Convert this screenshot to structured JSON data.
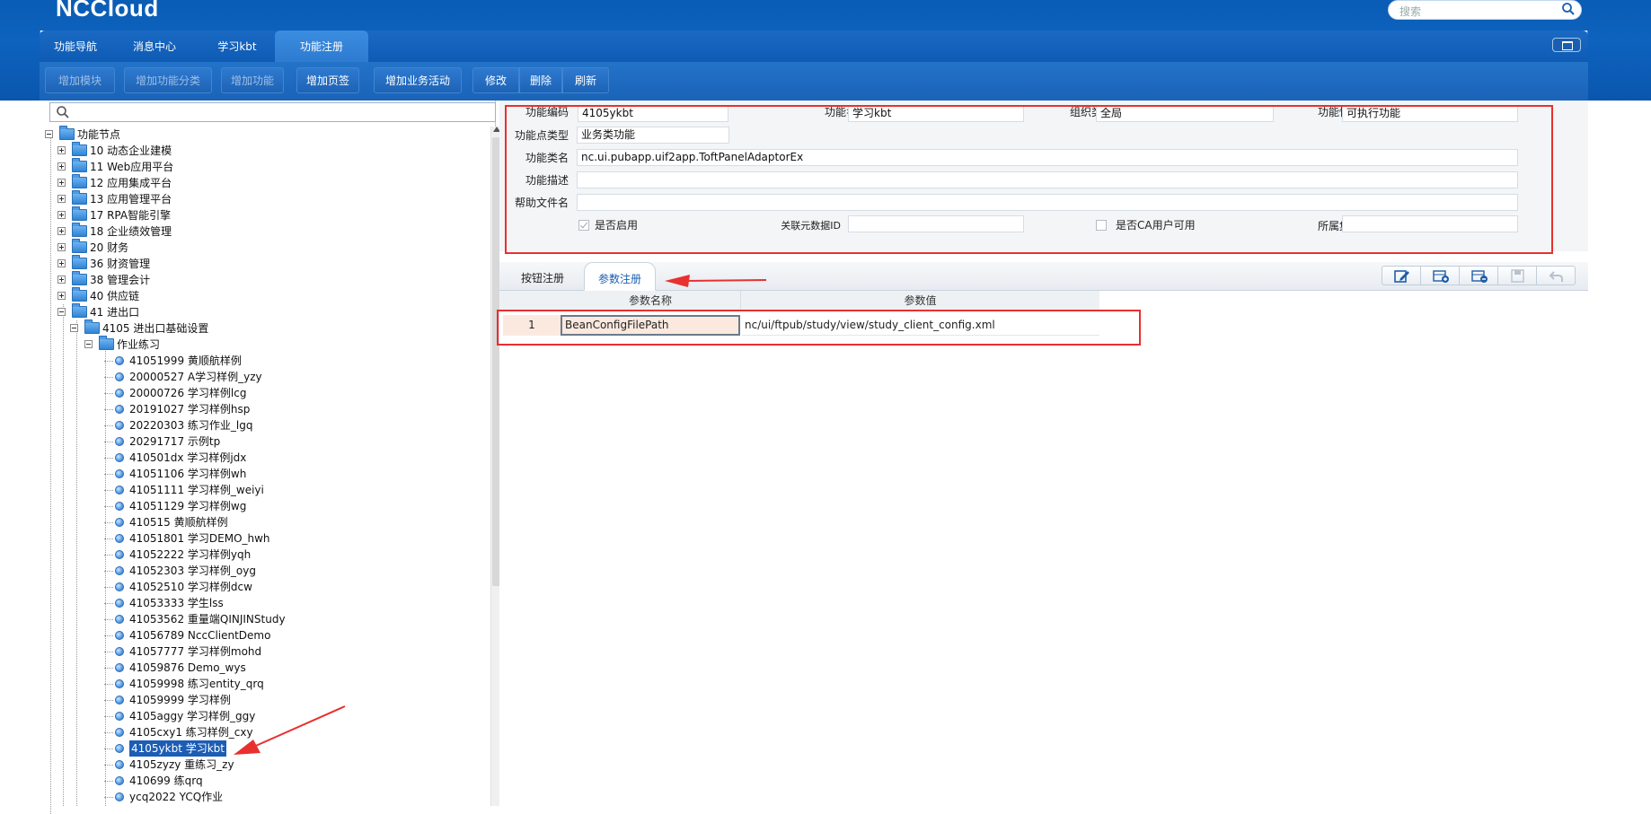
{
  "header": {
    "logo": "NCCloud",
    "search_placeholder": "搜索"
  },
  "top_tabs": [
    {
      "label": "功能导航",
      "active": false
    },
    {
      "label": "消息中心",
      "active": false
    },
    {
      "label": "学习kbt",
      "active": false
    },
    {
      "label": "功能注册",
      "active": true
    }
  ],
  "toolbar": {
    "buttons": [
      {
        "label": "增加模块",
        "enabled": false
      },
      {
        "label": "增加功能分类",
        "enabled": false
      },
      {
        "label": "增加功能",
        "enabled": false
      },
      {
        "label": "增加页签",
        "enabled": true
      },
      {
        "label": "增加业务活动",
        "enabled": true
      },
      {
        "label": "修改",
        "enabled": true
      },
      {
        "label": "删除",
        "enabled": true
      },
      {
        "label": "刷新",
        "enabled": true
      }
    ]
  },
  "tree": {
    "root": "功能节点",
    "modules": [
      {
        "code": "10",
        "name": "动态企业建模"
      },
      {
        "code": "11",
        "name": "Web应用平台"
      },
      {
        "code": "12",
        "name": "应用集成平台"
      },
      {
        "code": "13",
        "name": "应用管理平台"
      },
      {
        "code": "17",
        "name": "RPA智能引擎"
      },
      {
        "code": "18",
        "name": "企业绩效管理"
      },
      {
        "code": "20",
        "name": "财务"
      },
      {
        "code": "36",
        "name": "财资管理"
      },
      {
        "code": "38",
        "name": "管理会计"
      },
      {
        "code": "40",
        "name": "供应链"
      },
      {
        "code": "41",
        "name": "进出口"
      }
    ],
    "sub_module": "4105  进出口基础设置",
    "category": "作业练习",
    "leaves": [
      " 41051999  黄顺航样例",
      "20000527  A学习样例_yzy",
      "20000726  学习样例lcg",
      "20191027  学习样例hsp",
      "20220303  练习作业_lgq",
      "20291717  示例tp",
      "410501dx  学习样例jdx",
      "41051106  学习样例wh",
      "41051111  学习样例_weiyi",
      "41051129  学习样例wg",
      "410515  黄顺航样例",
      "41051801  学习DEMO_hwh",
      "41052222  学习样例yqh",
      "41052303  学习样例_oyg",
      "41052510  学习样例dcw",
      "41053333  学生lss",
      "41053562  重量端QINJINStudy",
      "41056789  NccClientDemo",
      "41057777  学习样例mohd",
      "41059876  Demo_wys",
      "41059998  练习entity_qrq",
      "41059999  学习样例",
      "4105aggy  学习样例_ggy",
      "4105cxy1  练习样例_cxy",
      "4105ykbt  学习kbt",
      "4105zyzy  重练习_zy",
      "410699  练qrq",
      "ycq2022  YCQ作业"
    ],
    "selected_index": 24
  },
  "form": {
    "func_code_label": "功能编码",
    "func_code": "4105ykbt",
    "func_name_label": "功能名称",
    "func_name": "学习kbt",
    "org_type_label": "组织类型",
    "org_type": "全局",
    "func_nature_label": "功能性质",
    "func_nature": "可执行功能",
    "node_type_label": "功能点类型",
    "node_type": "业务类功能",
    "class_name_label": "功能类名",
    "class_name": "nc.ui.pubapp.uif2app.ToftPanelAdaptorEx",
    "desc_label": "功能描述",
    "desc": "",
    "help_label": "帮助文件名",
    "help": "",
    "enabled_label": "是否启用",
    "enabled": true,
    "meta_id_label": "关联元数据ID",
    "meta_id": "",
    "ca_label": "是否CA用户可用",
    "ca": false,
    "group_label": "所属集团",
    "group": ""
  },
  "sub_tabs": [
    {
      "label": "按钮注册",
      "active": false
    },
    {
      "label": "参数注册",
      "active": true
    }
  ],
  "icon_buttons": [
    "edit-icon",
    "add-row-icon",
    "delete-row-icon",
    "save-icon",
    "undo-icon"
  ],
  "param_grid": {
    "headers": [
      "参数名称",
      "参数值"
    ],
    "rows": [
      {
        "index": "1",
        "name": "BeanConfigFilePath",
        "value": "nc/ui/ftpub/study/view/study_client_config.xml"
      }
    ]
  },
  "colors": {
    "banner": "#0d63bf",
    "highlight": "#e8302f",
    "selected": "#1c5db5"
  }
}
